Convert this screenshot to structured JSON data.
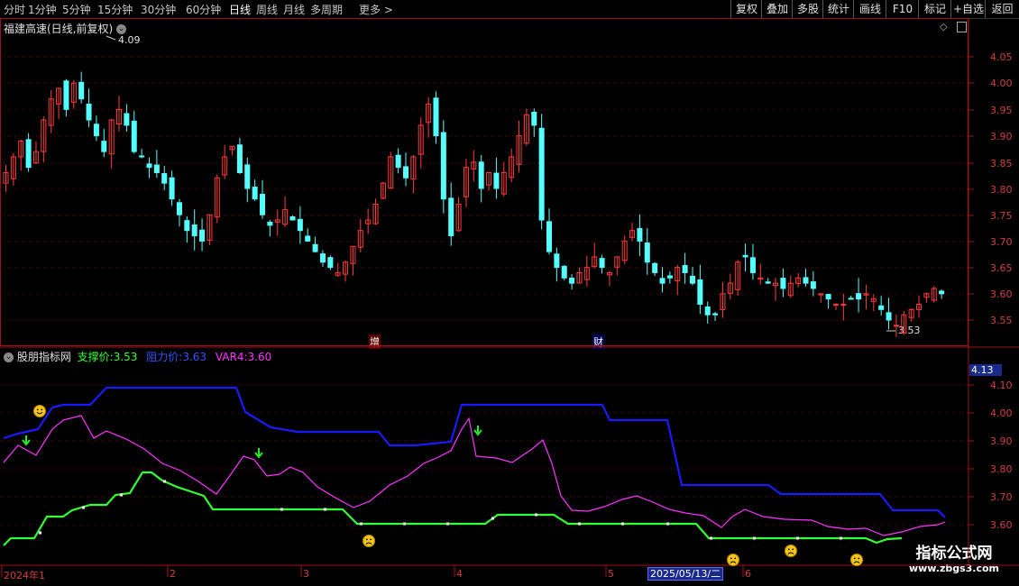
{
  "toolbar": {
    "periods": [
      "分时",
      "1分钟",
      "5分钟",
      "15分钟",
      "30分钟",
      "60分钟",
      "日线",
      "周线",
      "月线",
      "多周期",
      "更多"
    ],
    "active_period": "日线",
    "buttons": [
      "复权",
      "叠加",
      "多股",
      "统计",
      "画线",
      "F10",
      "标记",
      "+自选",
      "返回"
    ]
  },
  "main": {
    "title": "福建高速(日线,前复权)",
    "high_label": "4.09",
    "low_label": "3.53",
    "markers": [
      "增",
      "财"
    ],
    "y_ticks": [
      "4.05",
      "4.00",
      "3.95",
      "3.90",
      "3.85",
      "3.80",
      "3.75",
      "3.70",
      "3.65",
      "3.60",
      "3.55"
    ]
  },
  "indicator": {
    "name": "股朋指标网",
    "support_label": "支撑价:",
    "support_value": "3.53",
    "resist_label": "阻力价:",
    "resist_value": "3.63",
    "var_label": "VAR4:",
    "var_value": "3.60",
    "current_value": "4.13",
    "y_ticks": [
      "4.10",
      "4.00",
      "3.90",
      "3.80",
      "3.70",
      "3.60"
    ]
  },
  "dates": {
    "start": "2024年1",
    "months": [
      "2",
      "3",
      "4",
      "5",
      "6"
    ],
    "cursor_date": "2025/05/13/二"
  },
  "watermark": {
    "line1": "指标公式网",
    "line2": "www.zbgs3.com"
  },
  "colors": {
    "up": "#ff3b3b",
    "down": "#54ffff",
    "support": "#33ff33",
    "resist": "#1a1aff",
    "var4": "#ff33ff",
    "axis": "#a01010"
  },
  "icons": [
    "smile-icon",
    "frown-icon",
    "down-arrow-icon",
    "gear-icon",
    "diamond-icon",
    "panel-toggle-icon"
  ]
}
